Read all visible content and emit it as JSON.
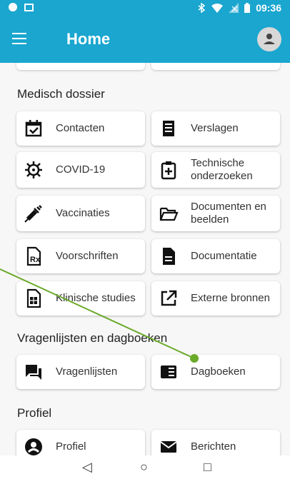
{
  "status_bar": {
    "time": "09:36",
    "bt_icon": "bluetooth-icon",
    "wifi_icon": "wifi-icon",
    "signal_icon": "signal-icon",
    "battery_icon": "battery-icon"
  },
  "app_bar": {
    "title": "Home",
    "menu_icon": "hamburger-menu-icon",
    "avatar_icon": "account-icon"
  },
  "sections": [
    {
      "title": "Medisch dossier",
      "items": [
        {
          "label": "Contacten",
          "icon": "calendar-check-icon"
        },
        {
          "label": "Verslagen",
          "icon": "receipt-icon"
        },
        {
          "label": "COVID-19",
          "icon": "virus-icon"
        },
        {
          "label": "Technische onderzoeken",
          "icon": "clipboard-plus-icon"
        },
        {
          "label": "Vaccinaties",
          "icon": "syringe-icon"
        },
        {
          "label": "Documenten en beelden",
          "icon": "folder-open-icon"
        },
        {
          "label": "Voorschriften",
          "icon": "prescription-icon"
        },
        {
          "label": "Documentatie",
          "icon": "file-document-icon"
        },
        {
          "label": "Klinische studies",
          "icon": "file-table-icon"
        },
        {
          "label": "Externe bronnen",
          "icon": "open-in-new-icon"
        }
      ]
    },
    {
      "title": "Vragenlijsten en dagboeken",
      "items": [
        {
          "label": "Vragenlijsten",
          "icon": "forum-icon"
        },
        {
          "label": "Dagboeken",
          "icon": "book-open-icon"
        }
      ]
    },
    {
      "title": "Profiel",
      "items": [
        {
          "label": "Profiel",
          "icon": "account-circle-icon"
        },
        {
          "label": "Berichten",
          "icon": "email-icon"
        }
      ]
    }
  ],
  "nav_bar": {
    "back": "◁",
    "home": "○",
    "recent": "□"
  },
  "colors": {
    "primary": "#1aa6cf",
    "annotation": "#6aaa2a"
  }
}
